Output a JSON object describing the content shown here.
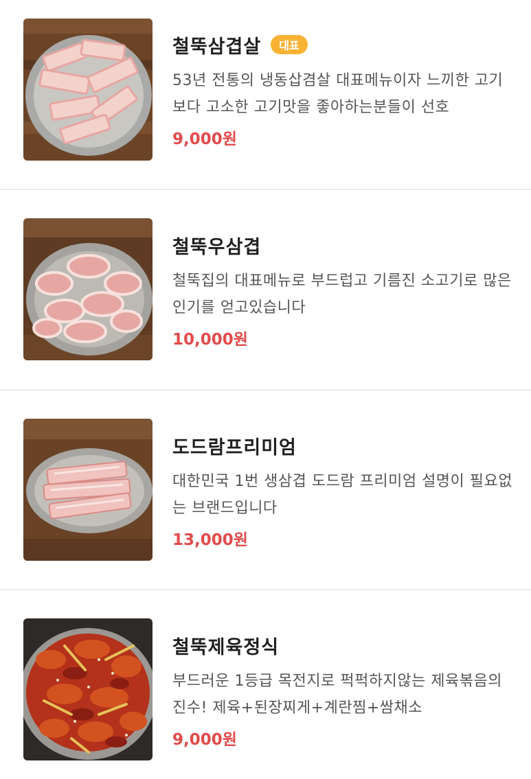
{
  "menu": {
    "items": [
      {
        "name": "철뚝삼겹살",
        "badge": "대표",
        "description": "53년 전통의 냉동삽겸살 대표메뉴이자 느끼한 고기보다 고소한 고기맛을 좋아하는분들이 선호",
        "price": "9,000원",
        "image": "frozen-pork-belly-photo"
      },
      {
        "name": "철뚝우삼겹",
        "description": "철뚝집의 대표메뉴로 부드럽고 기름진 소고기로 많은 인기를 얻고있습니다",
        "price": "10,000원",
        "image": "beef-brisket-rolls-photo"
      },
      {
        "name": "도드람프리미엄",
        "description": "대한민국 1번 생삼겹 도드람 프리미엄 설명이 필요없는 브랜드입니다",
        "price": "13,000원",
        "image": "fresh-pork-belly-photo"
      },
      {
        "name": "철뚝제육정식",
        "description": "부드러운 1등급 목전지로 퍽퍽하지않는 제육볶음의진수! 제육+된장찌게+계란찜+쌈채소",
        "price": "9,000원",
        "image": "spicy-pork-stirfry-photo"
      }
    ]
  },
  "colors": {
    "price": "#e34b4b",
    "badge_bg": "#f9b233",
    "divider": "#ececec"
  }
}
